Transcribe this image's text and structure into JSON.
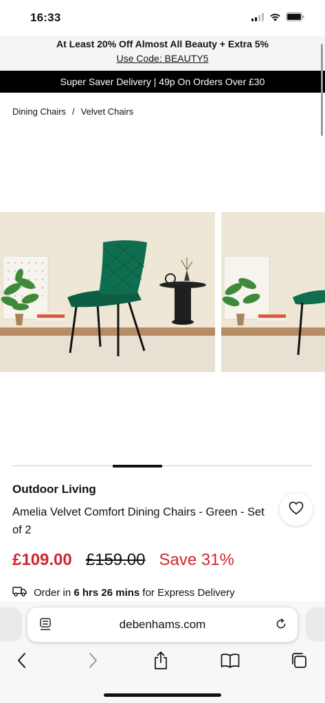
{
  "status_bar": {
    "time": "16:33",
    "icons": [
      "signal-icon",
      "wifi-icon",
      "battery-icon"
    ]
  },
  "promo": {
    "title": "At Least 20% Off Almost All Beauty + Extra 5%",
    "code_text": "Use Code: BEAUTY5"
  },
  "delivery_banner": {
    "text": "Super Saver Delivery | 49p On Orders Over £30"
  },
  "breadcrumb": {
    "items": [
      "Dining Chairs",
      "Velvet Chairs"
    ],
    "separator": "/"
  },
  "gallery": {
    "images": [
      "green-velvet-chair-photo",
      "green-velvet-chair-photo-2"
    ],
    "active_index": 1
  },
  "product": {
    "brand": "Outdoor Living",
    "title": "Amelia Velvet Comfort Dining Chairs - Green - Set of 2",
    "price_now": "£109.00",
    "price_was": "£159.00",
    "save_text": "Save 31%",
    "express": {
      "prefix": "Order in",
      "time": "6 hrs 26 mins",
      "suffix": "for Express Delivery"
    }
  },
  "browser": {
    "url": "debenhams.com",
    "toolbar": [
      "back-icon",
      "forward-icon",
      "share-icon",
      "bookmarks-icon",
      "tabs-icon"
    ]
  },
  "colors": {
    "sale_red": "#d1262e",
    "banner_black": "#000000",
    "promo_bg": "#f5f5f5",
    "chair_green": "#0e6e4f"
  }
}
